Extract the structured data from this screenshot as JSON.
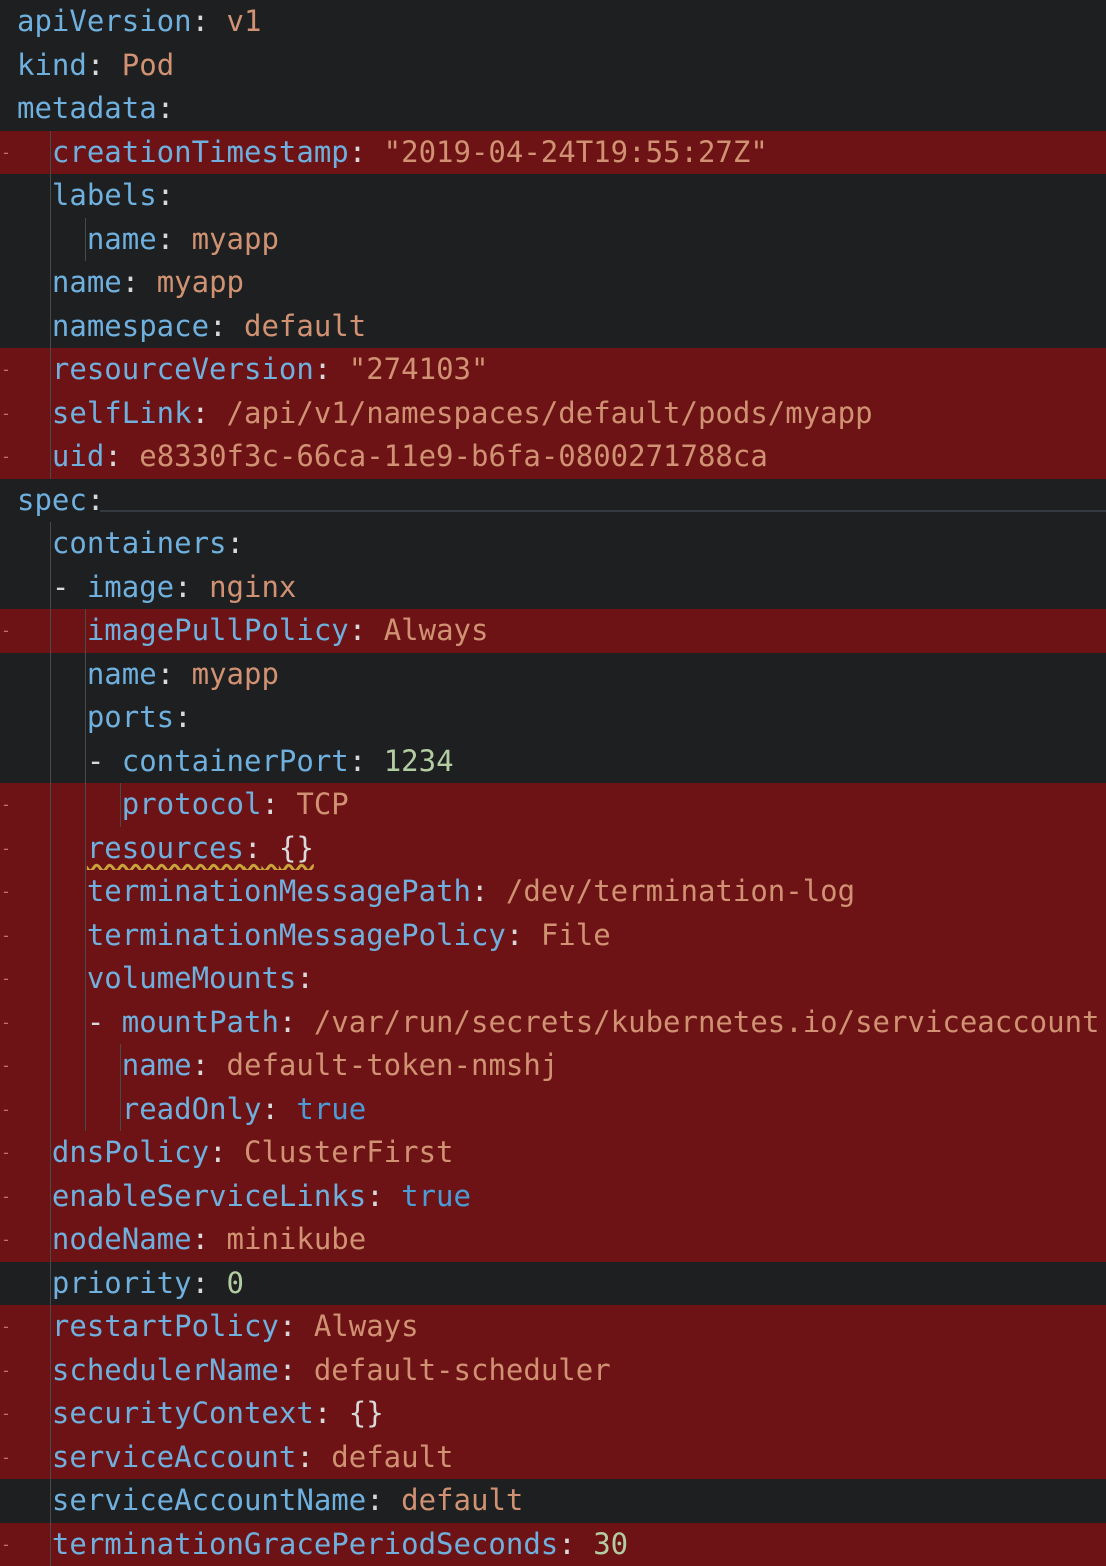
{
  "editor": {
    "language": "yaml",
    "colors": {
      "key": "#6fb0de",
      "string": "#d09272",
      "number": "#b3cda3",
      "boolean": "#4c9bd7",
      "punctuation": "#d9d9d9",
      "removed_line_bg": "#6d1315",
      "editor_bg": "#1e1f20"
    },
    "lines": [
      {
        "indent": "",
        "key": "apiVersion",
        "value": "v1",
        "vtype": "s",
        "removed": false
      },
      {
        "indent": "",
        "key": "kind",
        "value": "Pod",
        "vtype": "s",
        "removed": false
      },
      {
        "indent": "",
        "key": "metadata",
        "value": "",
        "vtype": "s",
        "removed": false
      },
      {
        "indent": "  ",
        "key": "creationTimestamp",
        "value": "\"2019-04-24T19:55:27Z\"",
        "vtype": "s",
        "removed": true
      },
      {
        "indent": "  ",
        "key": "labels",
        "value": "",
        "vtype": "s",
        "removed": false
      },
      {
        "indent": "    ",
        "key": "name",
        "value": "myapp",
        "vtype": "s",
        "removed": false
      },
      {
        "indent": "  ",
        "key": "name",
        "value": "myapp",
        "vtype": "s",
        "removed": false
      },
      {
        "indent": "  ",
        "key": "namespace",
        "value": "default",
        "vtype": "s",
        "removed": false
      },
      {
        "indent": "  ",
        "key": "resourceVersion",
        "value": "\"274103\"",
        "vtype": "s",
        "removed": true
      },
      {
        "indent": "  ",
        "key": "selfLink",
        "value": "/api/v1/namespaces/default/pods/myapp",
        "vtype": "s",
        "removed": true
      },
      {
        "indent": "  ",
        "key": "uid",
        "value": "e8330f3c-66ca-11e9-b6fa-0800271788ca",
        "vtype": "s",
        "removed": true
      },
      {
        "indent": "",
        "key": "spec",
        "value": "",
        "vtype": "s",
        "removed": false
      },
      {
        "indent": "  ",
        "key": "containers",
        "value": "",
        "vtype": "s",
        "removed": false
      },
      {
        "indent": "  - ",
        "key": "image",
        "value": "nginx",
        "vtype": "s",
        "removed": false
      },
      {
        "indent": "    ",
        "key": "imagePullPolicy",
        "value": "Always",
        "vtype": "s",
        "removed": true
      },
      {
        "indent": "    ",
        "key": "name",
        "value": "myapp",
        "vtype": "s",
        "removed": false
      },
      {
        "indent": "    ",
        "key": "ports",
        "value": "",
        "vtype": "s",
        "removed": false
      },
      {
        "indent": "    - ",
        "key": "containerPort",
        "value": "1234",
        "vtype": "n",
        "removed": false
      },
      {
        "indent": "      ",
        "key": "protocol",
        "value": "TCP",
        "vtype": "s",
        "removed": true
      },
      {
        "indent": "    ",
        "key": "resources",
        "value": "{}",
        "vtype": "p",
        "removed": true,
        "warning": true
      },
      {
        "indent": "    ",
        "key": "terminationMessagePath",
        "value": "/dev/termination-log",
        "vtype": "s",
        "removed": true
      },
      {
        "indent": "    ",
        "key": "terminationMessagePolicy",
        "value": "File",
        "vtype": "s",
        "removed": true
      },
      {
        "indent": "    ",
        "key": "volumeMounts",
        "value": "",
        "vtype": "s",
        "removed": true
      },
      {
        "indent": "    - ",
        "key": "mountPath",
        "value": "/var/run/secrets/kubernetes.io/serviceaccount",
        "vtype": "s",
        "removed": true
      },
      {
        "indent": "      ",
        "key": "name",
        "value": "default-token-nmshj",
        "vtype": "s",
        "removed": true
      },
      {
        "indent": "      ",
        "key": "readOnly",
        "value": "true",
        "vtype": "b",
        "removed": true
      },
      {
        "indent": "  ",
        "key": "dnsPolicy",
        "value": "ClusterFirst",
        "vtype": "s",
        "removed": true
      },
      {
        "indent": "  ",
        "key": "enableServiceLinks",
        "value": "true",
        "vtype": "b",
        "removed": true
      },
      {
        "indent": "  ",
        "key": "nodeName",
        "value": "minikube",
        "vtype": "s",
        "removed": true
      },
      {
        "indent": "  ",
        "key": "priority",
        "value": "0",
        "vtype": "n",
        "removed": false
      },
      {
        "indent": "  ",
        "key": "restartPolicy",
        "value": "Always",
        "vtype": "s",
        "removed": true
      },
      {
        "indent": "  ",
        "key": "schedulerName",
        "value": "default-scheduler",
        "vtype": "s",
        "removed": true
      },
      {
        "indent": "  ",
        "key": "securityContext",
        "value": "{}",
        "vtype": "p",
        "removed": true
      },
      {
        "indent": "  ",
        "key": "serviceAccount",
        "value": "default",
        "vtype": "s",
        "removed": true
      },
      {
        "indent": "  ",
        "key": "serviceAccountName",
        "value": "default",
        "vtype": "s",
        "removed": false
      },
      {
        "indent": "  ",
        "key": "terminationGracePeriodSeconds",
        "value": "30",
        "vtype": "n",
        "removed": true
      }
    ]
  }
}
